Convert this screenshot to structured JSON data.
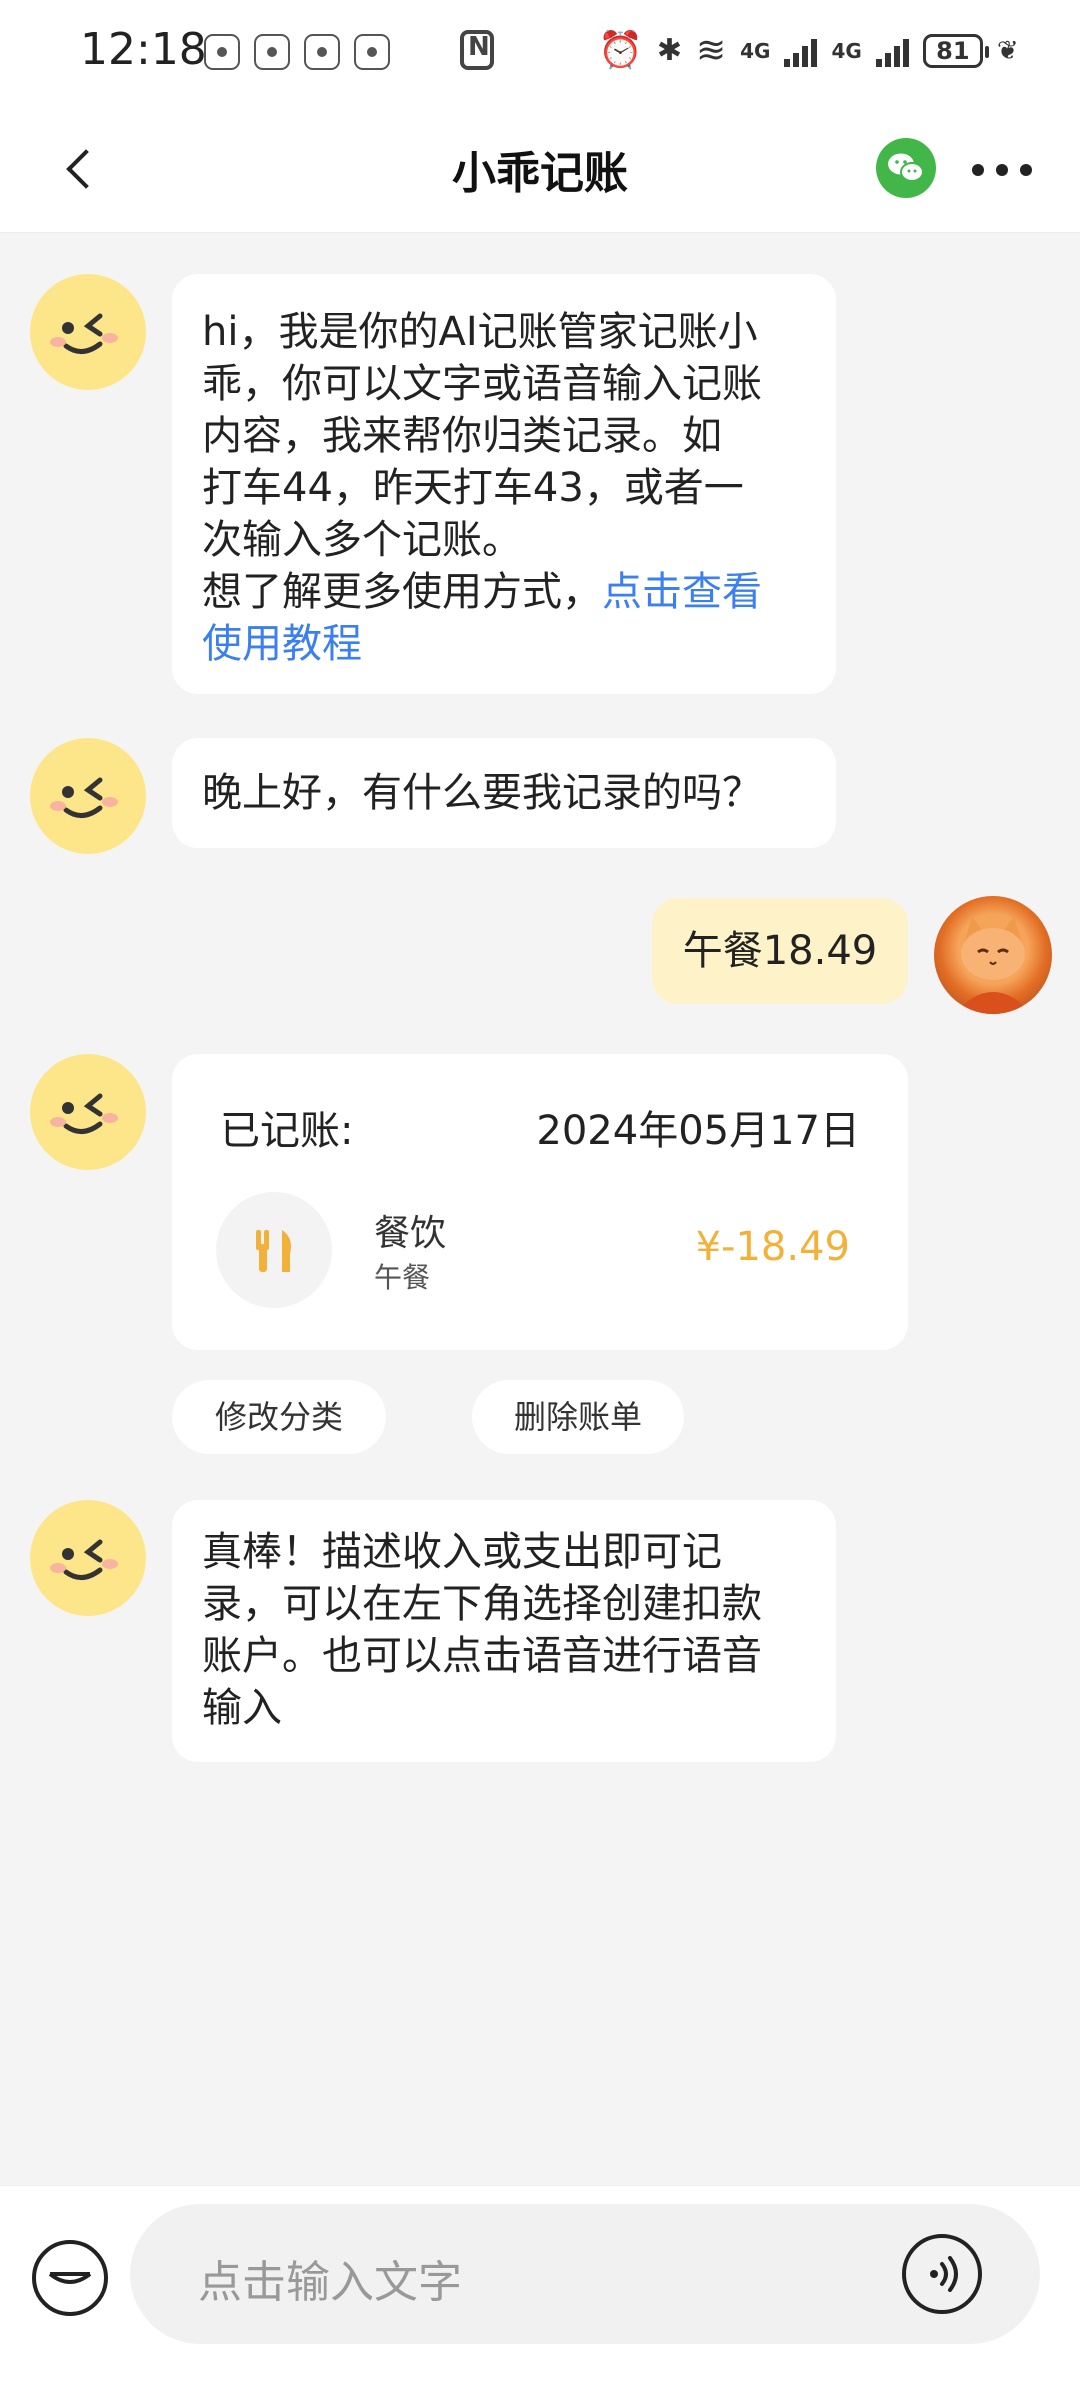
{
  "status_bar": {
    "time": "12:18",
    "network_1": "4G",
    "network_2": "4G",
    "battery": "81"
  },
  "header": {
    "title": "小乖记账",
    "back_icon": "chevron-left-icon",
    "wechat_icon": "wechat-icon",
    "more_icon": "more-horizontal-icon"
  },
  "chat": {
    "welcome": {
      "lines": [
        "hi，我是你的AI记账管家记账小",
        "乖，你可以文字或语音输入记账",
        "内容，我来帮你归类记录。如",
        "打车44，昨天打车43，或者一",
        "次输入多个记账。"
      ],
      "tutorial_prefix": "想了解更多使用方式，",
      "tutorial_link_line1": "点击查看",
      "tutorial_link_line2": "使用教程"
    },
    "greeting": "晚上好，有什么要我记录的吗？",
    "user_message": "午餐18.49",
    "record_card": {
      "label": "已记账:",
      "date": "2024年05月17日",
      "category": "餐饮",
      "note": "午餐",
      "amount": "¥-18.49",
      "category_icon": "fork-knife-icon"
    },
    "actions": {
      "modify_category": "修改分类",
      "delete_bill": "删除账单"
    },
    "tip": {
      "lines": [
        "真棒！描述收入或支出即可记",
        "录，可以在左下角选择创建扣款",
        "账户。也可以点击语音进行语音",
        "输入"
      ]
    }
  },
  "input": {
    "placeholder": "点击输入文字",
    "wallet_icon": "wallet-icon",
    "voice_icon": "voice-icon"
  },
  "colors": {
    "accent_link": "#3b7ff0",
    "amount": "#f2b23a",
    "user_bubble": "#fdf2c8",
    "bot_avatar": "#fde68a",
    "wechat": "#43b649"
  }
}
